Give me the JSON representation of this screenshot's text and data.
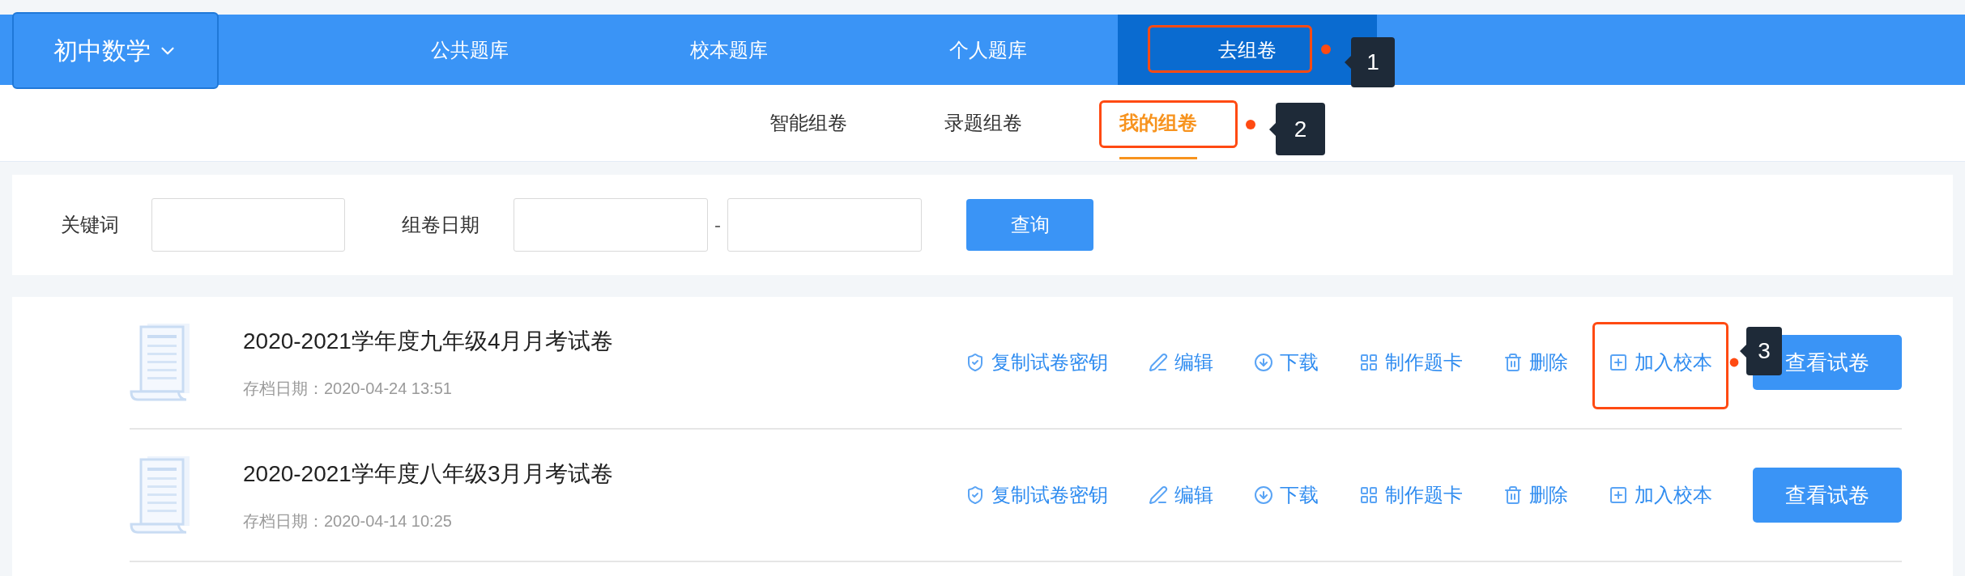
{
  "subject_selector": {
    "label": "初中数学"
  },
  "nav_tabs": [
    {
      "label": "公共题库",
      "selected": false
    },
    {
      "label": "校本题库",
      "selected": false
    },
    {
      "label": "个人题库",
      "selected": false
    },
    {
      "label": "去组卷",
      "selected": true,
      "callout": "1"
    }
  ],
  "sub_tabs": [
    {
      "label": "智能组卷",
      "selected": false
    },
    {
      "label": "录题组卷",
      "selected": false
    },
    {
      "label": "我的组卷",
      "selected": true,
      "callout": "2"
    }
  ],
  "filters": {
    "keyword_label": "关键词",
    "date_label": "组卷日期",
    "range_separator": "-",
    "search_button": "查询"
  },
  "papers": [
    {
      "title": "2020-2021学年度九年级4月月考试卷",
      "archived": "存档日期：2020-04-24 13:51",
      "view_button": "查看试卷",
      "actions": [
        {
          "kind": "copy-key",
          "label": "复制试卷密钥"
        },
        {
          "kind": "edit",
          "label": "编辑"
        },
        {
          "kind": "download",
          "label": "下载"
        },
        {
          "kind": "answer-card",
          "label": "制作题卡"
        },
        {
          "kind": "delete",
          "label": "删除"
        },
        {
          "kind": "add-to-school",
          "label": "加入校本",
          "callout": "3"
        }
      ]
    },
    {
      "title": "2020-2021学年度八年级3月月考试卷",
      "archived": "存档日期：2020-04-14 10:25",
      "view_button": "查看试卷",
      "actions": [
        {
          "kind": "copy-key",
          "label": "复制试卷密钥"
        },
        {
          "kind": "edit",
          "label": "编辑"
        },
        {
          "kind": "download",
          "label": "下载"
        },
        {
          "kind": "answer-card",
          "label": "制作题卡"
        },
        {
          "kind": "delete",
          "label": "删除"
        },
        {
          "kind": "add-to-school",
          "label": "加入校本"
        }
      ]
    }
  ]
}
